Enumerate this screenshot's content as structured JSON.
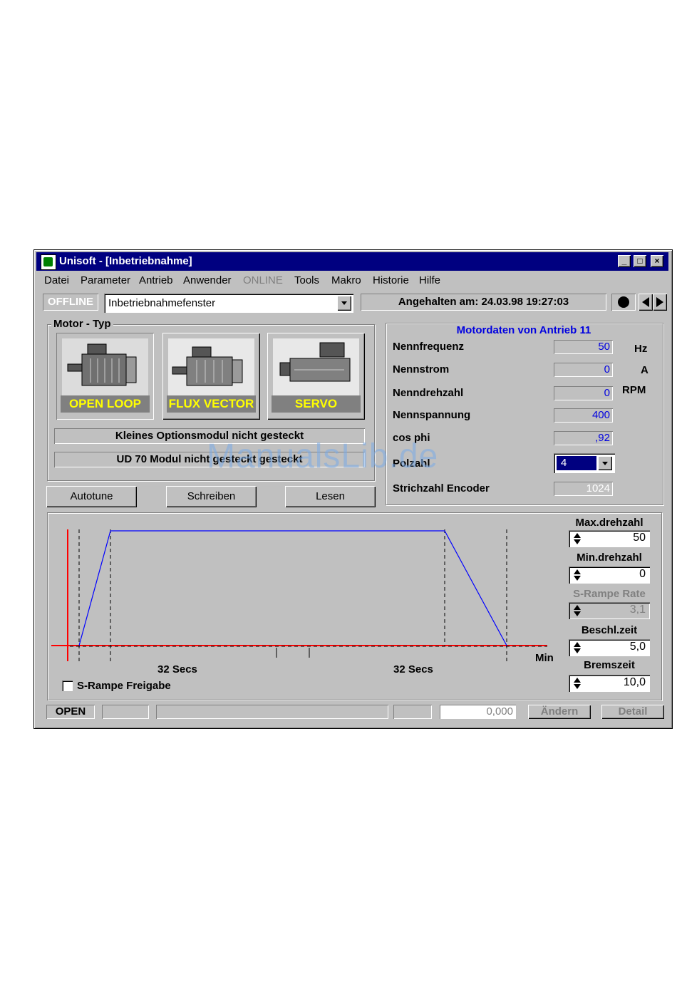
{
  "window": {
    "title": "Unisoft - [Inbetriebnahme]",
    "controls": [
      "_",
      "□",
      "×"
    ]
  },
  "menu": {
    "items": [
      "Datei",
      "Parameter",
      "Antrieb",
      "Anwender",
      "ONLINE",
      "Tools",
      "Makro",
      "Historie",
      "Hilfe"
    ]
  },
  "toolbar": {
    "mode": "OFFLINE",
    "window_select": "Inbetriebnahmefenster",
    "status": "Angehalten am: 24.03.98 19:27:03"
  },
  "motor_type": {
    "group_label": "Motor - Typ",
    "buttons": [
      "OPEN LOOP",
      "FLUX VECTOR",
      "SERVO"
    ],
    "info1": "Kleines Optionsmodul nicht gesteckt",
    "info2": "UD 70 Modul nicht gesteckt gesteckt"
  },
  "actions": {
    "autotune": "Autotune",
    "schreiben": "Schreiben",
    "lesen": "Lesen"
  },
  "motordata": {
    "header": "Motordaten  von Antrieb 11",
    "rows": [
      {
        "label": "Nennfrequenz",
        "value": "50",
        "unit": "Hz"
      },
      {
        "label": "Nennstrom",
        "value": "0",
        "unit": "A"
      },
      {
        "label": "Nenndrehzahl",
        "value": "0",
        "unit": "RPM"
      },
      {
        "label": "Nennspannung",
        "value": "400",
        "unit": ""
      },
      {
        "label": "cos phi",
        "value": ",92",
        "unit": ""
      },
      {
        "label": "Polzahl",
        "value": "4",
        "unit": ""
      },
      {
        "label": "Strichzahl Encoder",
        "value": "1024",
        "unit": ""
      }
    ]
  },
  "ramp": {
    "accel_label": "32 Secs",
    "decel_label": "32 Secs",
    "min_label": "Min",
    "s_rampe_checkbox": "S-Rampe Freigabe",
    "s_rampe_checked": false,
    "colors": {
      "ramp_line": "#0000ff",
      "axis": "#ff0000"
    }
  },
  "params": {
    "max_label": "Max.drehzahl",
    "max_value": "50",
    "min_label": "Min.drehzahl",
    "min_value": "0",
    "srate_label": "S-Rampe Rate",
    "srate_value": "3,1",
    "beschl_label": "Beschl.zeit",
    "beschl_value": "5,0",
    "brems_label": "Bremszeit",
    "brems_value": "10,0"
  },
  "statusbar": {
    "state": "OPEN",
    "value": "0,000",
    "andern": "Ändern",
    "detail": "Detail"
  },
  "watermark": "ManualsLib.de"
}
